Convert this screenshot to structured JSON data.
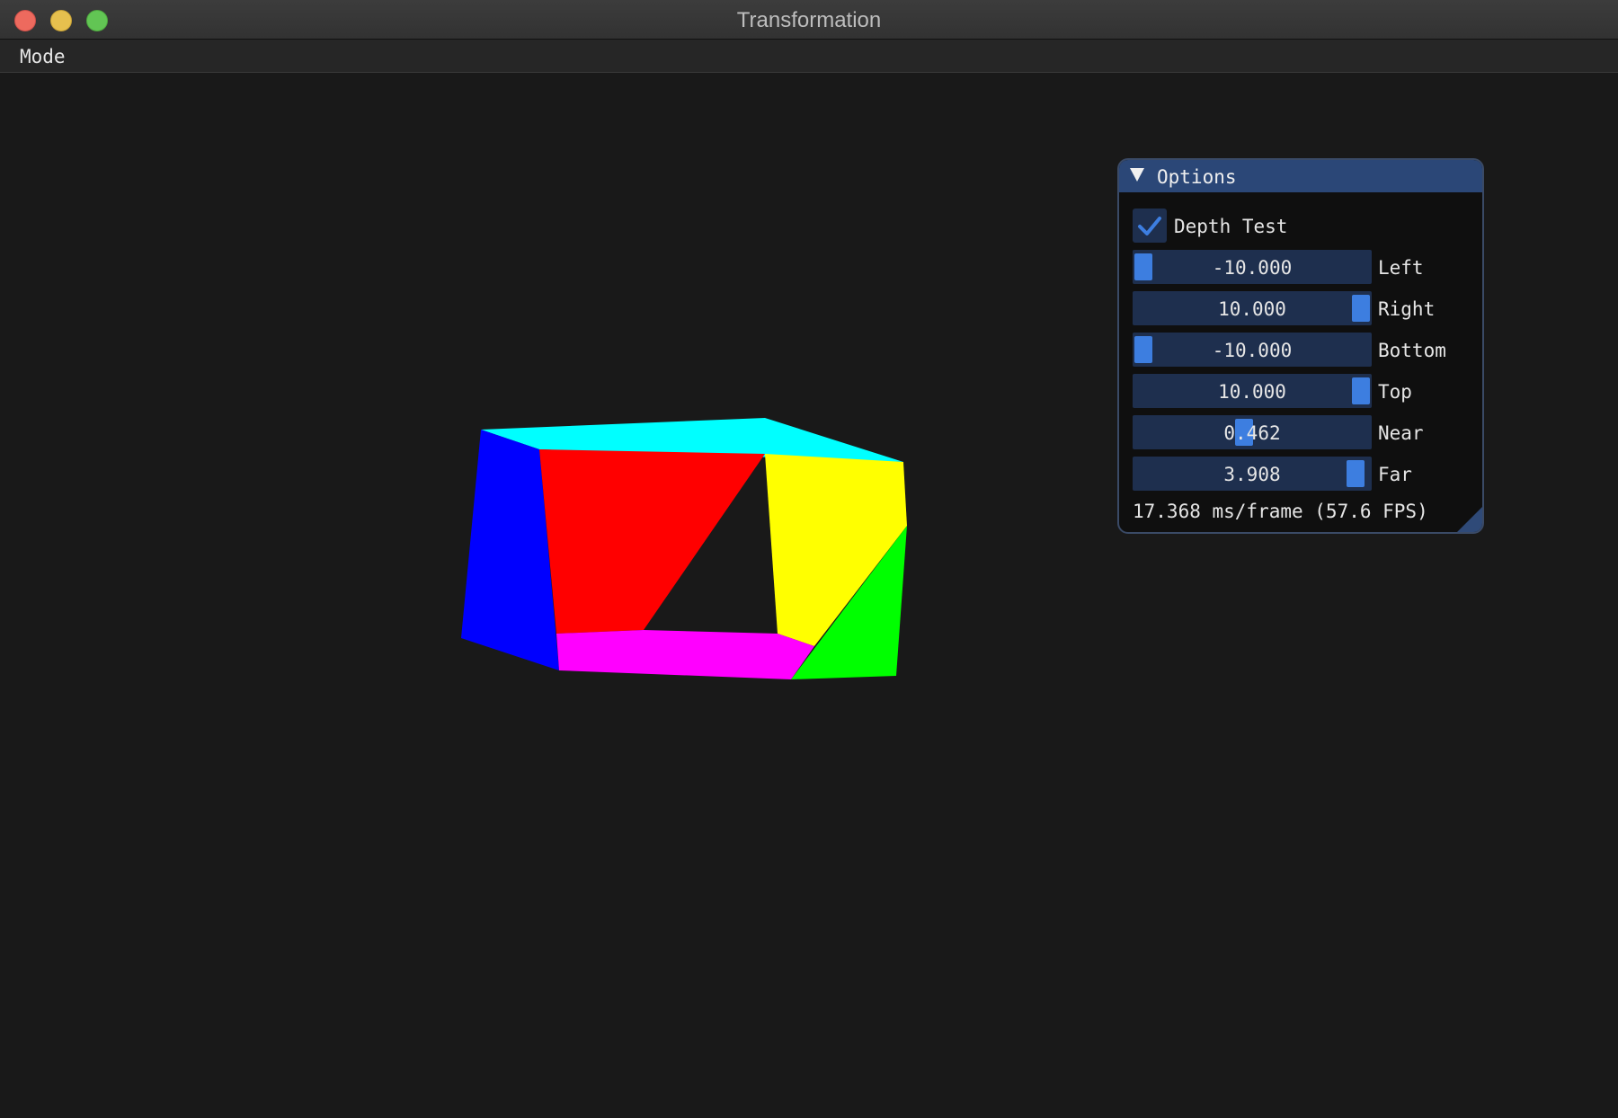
{
  "window": {
    "title": "Transformation"
  },
  "menu": {
    "items": [
      {
        "label": "Mode"
      }
    ]
  },
  "options": {
    "title": "Options",
    "depth_test": {
      "label": "Depth Test",
      "checked": true
    },
    "sliders": [
      {
        "label": "Left",
        "value": "-10.000",
        "min": -10,
        "max": 10,
        "current": -10
      },
      {
        "label": "Right",
        "value": "10.000",
        "min": -10,
        "max": 10,
        "current": 10
      },
      {
        "label": "Bottom",
        "value": "-10.000",
        "min": -10,
        "max": 10,
        "current": -10
      },
      {
        "label": "Top",
        "value": "10.000",
        "min": -10,
        "max": 10,
        "current": 10
      },
      {
        "label": "Near",
        "value": "0.462",
        "min": 0.0,
        "max": 1.0,
        "current": 0.462
      },
      {
        "label": "Far",
        "value": "3.908",
        "min": 0.0,
        "max": 4.0,
        "current": 3.908
      }
    ],
    "fps_text": "17.368 ms/frame (57.6 FPS)"
  },
  "colors": {
    "accent": "#3d7ee0",
    "frame_bg": "#1e2f4e",
    "title_bg": "#2b4777",
    "cube_faces": {
      "top": "#00ffff",
      "left": "#0000ff",
      "front": "#ff0000",
      "right": "#ffff00",
      "bottom": "#ff00ff",
      "right_lower": "#00ff00"
    }
  }
}
